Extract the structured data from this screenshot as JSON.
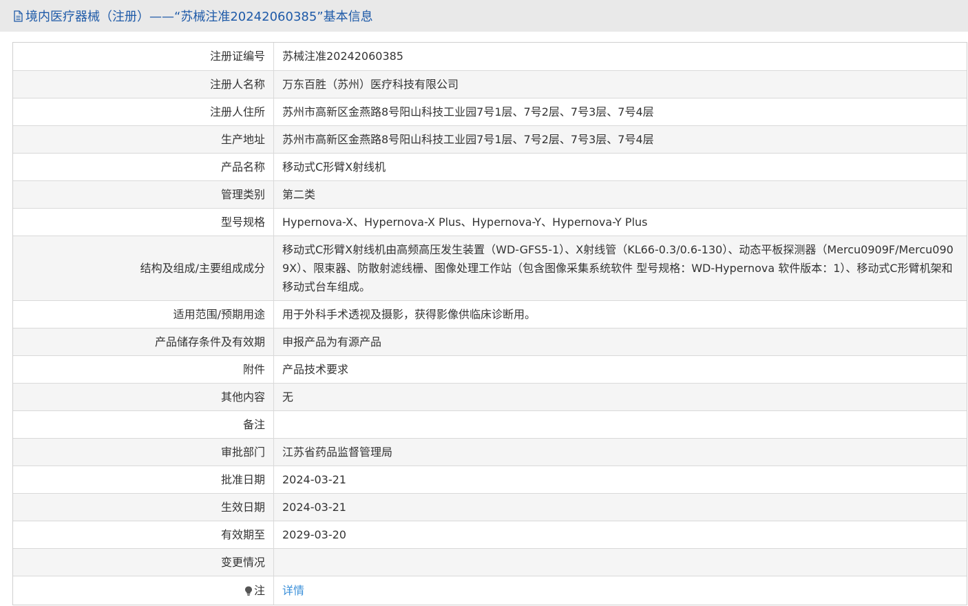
{
  "header": {
    "title": "境内医疗器械（注册）——“苏械注准20242060385”基本信息",
    "icon": "document-icon",
    "color": "#1e5aa8"
  },
  "rows": [
    {
      "label": "注册证编号",
      "value": "苏械注准20242060385"
    },
    {
      "label": "注册人名称",
      "value": "万东百胜（苏州）医疗科技有限公司"
    },
    {
      "label": "注册人住所",
      "value": "苏州市高新区金燕路8号阳山科技工业园7号1层、7号2层、7号3层、7号4层"
    },
    {
      "label": "生产地址",
      "value": "苏州市高新区金燕路8号阳山科技工业园7号1层、7号2层、7号3层、7号4层"
    },
    {
      "label": "产品名称",
      "value": "移动式C形臂X射线机"
    },
    {
      "label": "管理类别",
      "value": "第二类"
    },
    {
      "label": "型号规格",
      "value": "Hypernova-X、Hypernova-X Plus、Hypernova-Y、Hypernova-Y Plus"
    },
    {
      "label": "结构及组成/主要组成成分",
      "value": "移动式C形臂X射线机由高频高压发生装置（WD-GFS5-1）、X射线管（KL66-0.3/0.6-130）、动态平板探测器（Mercu0909F/Mercu0909X）、限束器、防散射滤线栅、图像处理工作站（包含图像采集系统软件 型号规格：WD-Hypernova 软件版本：1）、移动式C形臂机架和移动式台车组成。"
    },
    {
      "label": "适用范围/预期用途",
      "value": "用于外科手术透视及摄影，获得影像供临床诊断用。"
    },
    {
      "label": "产品储存条件及有效期",
      "value": "申报产品为有源产品"
    },
    {
      "label": "附件",
      "value": "产品技术要求"
    },
    {
      "label": "其他内容",
      "value": "无"
    },
    {
      "label": "备注",
      "value": ""
    },
    {
      "label": "审批部门",
      "value": "江苏省药品监督管理局"
    },
    {
      "label": "批准日期",
      "value": "2024-03-21"
    },
    {
      "label": "生效日期",
      "value": "2024-03-21"
    },
    {
      "label": "有效期至",
      "value": "2029-03-20"
    },
    {
      "label": "变更情况",
      "value": ""
    }
  ],
  "note": {
    "label": "注",
    "icon": "bulb-icon",
    "link_text": "详情",
    "link_color": "#3a8fd9"
  }
}
